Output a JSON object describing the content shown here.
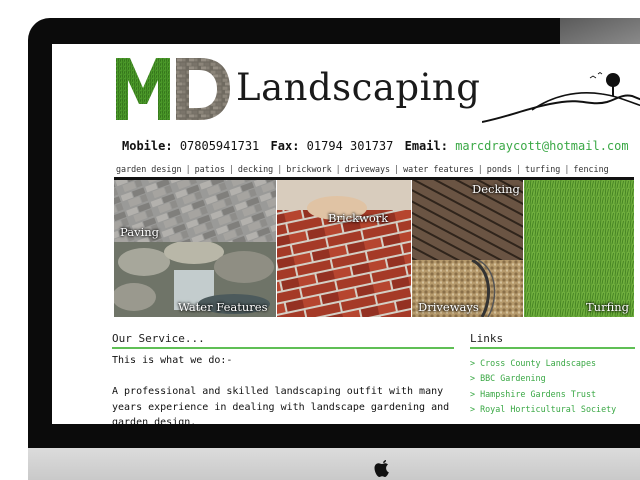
{
  "header": {
    "logo_letters": "MD",
    "logo_word": "Landscaping"
  },
  "contact": {
    "mobile_label": "Mobile:",
    "mobile": "07805941731",
    "fax_label": "Fax:",
    "fax": "01794 301737",
    "email_label": "Email:",
    "email": "marcdraycott@hotmail.com"
  },
  "nav": [
    "garden design",
    "patios",
    "decking",
    "brickwork",
    "driveways",
    "water features",
    "ponds",
    "turfing",
    "fencing"
  ],
  "tiles": {
    "paving": "Paving",
    "brickwork": "Brickwork",
    "decking": "Decking",
    "water_features": "Water Features",
    "driveways": "Driveways",
    "turfing": "Turfing"
  },
  "service": {
    "heading": "Our Service...",
    "intro": "This is what we do:-",
    "para": "A professional and skilled landscaping outfit with many years experience in dealing with landscape gardening and garden design."
  },
  "links": {
    "heading": "Links",
    "items": [
      "> Cross County Landscapes",
      "> BBC Gardening",
      "> Hampshire Gardens Trust",
      "> Royal Horticultural Society"
    ]
  },
  "colors": {
    "accent": "#3aa845",
    "rule": "#5fbf55"
  }
}
